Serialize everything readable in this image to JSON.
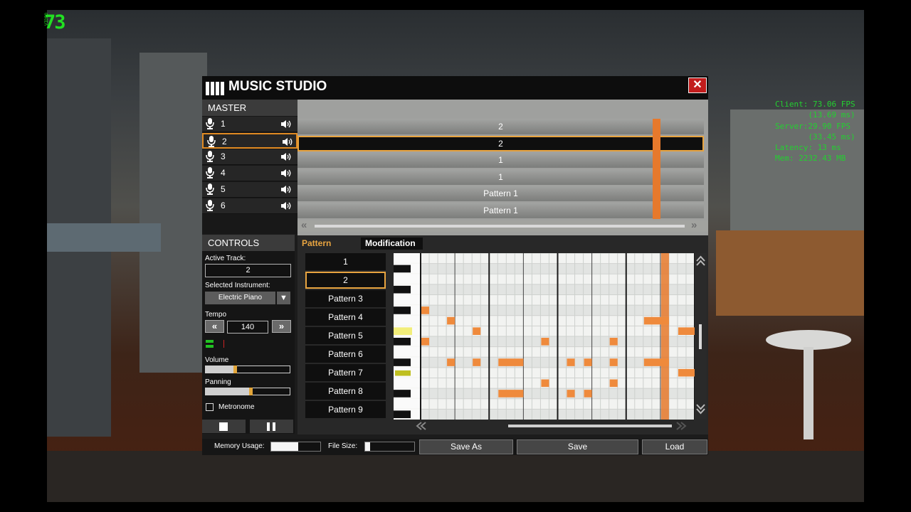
{
  "hud": {
    "fps": "73",
    "fps_tag": "VIDEO",
    "stats": [
      "Client: 73.06 FPS",
      "       (13.69 ms)",
      "Server:29.90 FPS",
      "       (33.45 ms)",
      "Latency: 13 ms",
      "Mem: 2232.43 MB"
    ]
  },
  "window": {
    "title": "MUSIC STUDIO",
    "close_label": "✕"
  },
  "master": {
    "header": "MASTER",
    "tracks": [
      {
        "label": "1",
        "lane": "2"
      },
      {
        "label": "2",
        "lane": "2",
        "selected": true
      },
      {
        "label": "3",
        "lane": "1"
      },
      {
        "label": "4",
        "lane": "1"
      },
      {
        "label": "5",
        "lane": "Pattern 1"
      },
      {
        "label": "6",
        "lane": "Pattern 1"
      }
    ]
  },
  "controls": {
    "header": "CONTROLS",
    "active_track_label": "Active Track:",
    "active_track_value": "2",
    "instrument_label": "Selected Instrument:",
    "instrument_value": "Electric Piano",
    "tempo_label": "Tempo",
    "tempo_value": "140",
    "volume_label": "Volume",
    "volume_level": 0.35,
    "panning_label": "Panning",
    "panning_level": 0.53,
    "metronome_label": "Metronome",
    "metronome_checked": false
  },
  "tabs": {
    "pattern": "Pattern",
    "modification": "Modification"
  },
  "patterns": [
    {
      "label": "1"
    },
    {
      "label": "2",
      "selected": true
    },
    {
      "label": "Pattern 3"
    },
    {
      "label": "Pattern 4"
    },
    {
      "label": "Pattern 5"
    },
    {
      "label": "Pattern 6"
    },
    {
      "label": "Pattern 7"
    },
    {
      "label": "Pattern 8"
    },
    {
      "label": "Pattern 9"
    }
  ],
  "piano_roll": {
    "columns": 32,
    "rows": 16,
    "playhead_column": 28,
    "notes": [
      {
        "col": 0,
        "row": 5,
        "len": 1
      },
      {
        "col": 3,
        "row": 6,
        "len": 1
      },
      {
        "col": 6,
        "row": 7,
        "len": 1
      },
      {
        "col": 14,
        "row": 8,
        "len": 1
      },
      {
        "col": 22,
        "row": 8,
        "len": 1
      },
      {
        "col": 26,
        "row": 6,
        "len": 3
      },
      {
        "col": 30,
        "row": 7,
        "len": 2
      },
      {
        "col": 0,
        "row": 8,
        "len": 1
      },
      {
        "col": 3,
        "row": 10,
        "len": 1
      },
      {
        "col": 6,
        "row": 10,
        "len": 1
      },
      {
        "col": 9,
        "row": 10,
        "len": 3
      },
      {
        "col": 17,
        "row": 10,
        "len": 1
      },
      {
        "col": 19,
        "row": 10,
        "len": 1
      },
      {
        "col": 22,
        "row": 10,
        "len": 1
      },
      {
        "col": 26,
        "row": 10,
        "len": 3
      },
      {
        "col": 30,
        "row": 11,
        "len": 2
      },
      {
        "col": 14,
        "row": 12,
        "len": 1
      },
      {
        "col": 22,
        "row": 12,
        "len": 1
      },
      {
        "col": 9,
        "row": 13,
        "len": 3
      },
      {
        "col": 17,
        "row": 13,
        "len": 1
      },
      {
        "col": 19,
        "row": 13,
        "len": 1
      }
    ]
  },
  "footer": {
    "memory_label": "Memory Usage:",
    "memory_level": 0.55,
    "filesize_label": "File Size:",
    "filesize_level": 0.1,
    "save_as": "Save As",
    "save": "Save",
    "load": "Load"
  },
  "colors": {
    "accent": "#e8a440",
    "note": "#ef8a3c",
    "playhead": "#e6792c",
    "close": "#c21d1d"
  }
}
